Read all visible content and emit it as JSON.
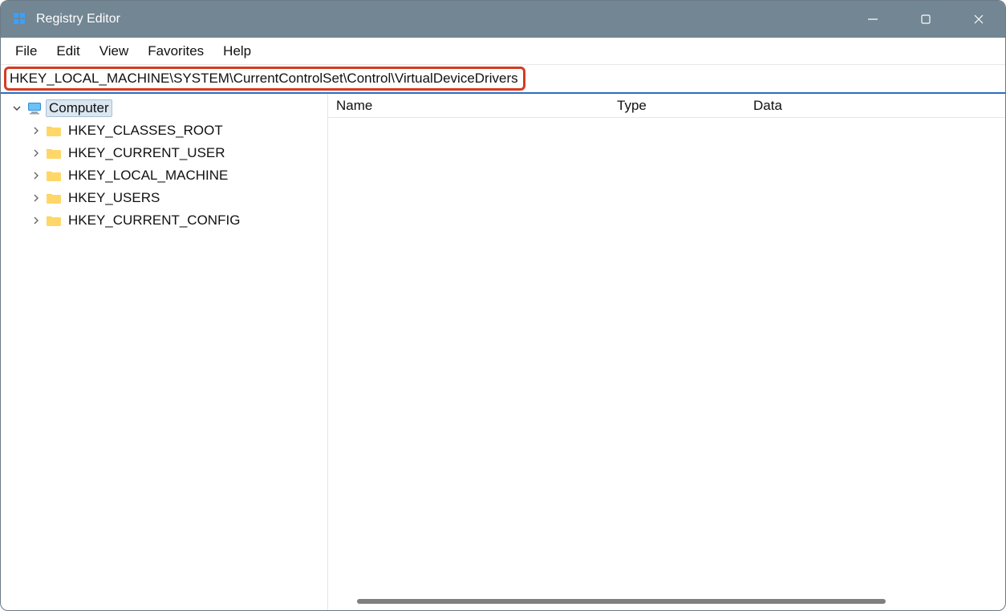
{
  "window": {
    "title": "Registry Editor"
  },
  "menubar": {
    "items": [
      "File",
      "Edit",
      "View",
      "Favorites",
      "Help"
    ]
  },
  "addressbar": {
    "value": "HKEY_LOCAL_MACHINE\\SYSTEM\\CurrentControlSet\\Control\\VirtualDeviceDrivers"
  },
  "tree": {
    "root": {
      "label": "Computer",
      "expanded": true,
      "selected": true
    },
    "children": [
      {
        "label": "HKEY_CLASSES_ROOT"
      },
      {
        "label": "HKEY_CURRENT_USER"
      },
      {
        "label": "HKEY_LOCAL_MACHINE"
      },
      {
        "label": "HKEY_USERS"
      },
      {
        "label": "HKEY_CURRENT_CONFIG"
      }
    ]
  },
  "list": {
    "columns": {
      "name": "Name",
      "type": "Type",
      "data": "Data"
    },
    "rows": []
  }
}
